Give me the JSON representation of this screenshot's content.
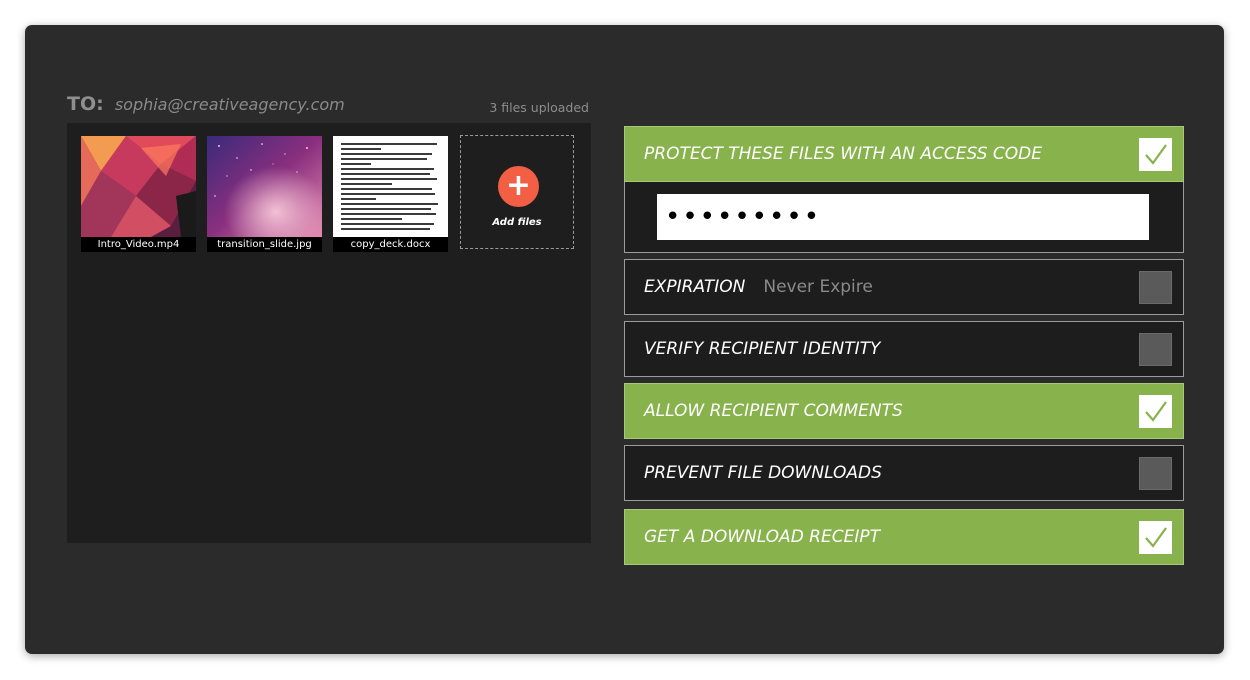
{
  "recipient": {
    "to_label": "TO:",
    "email": "sophia@creativeagency.com"
  },
  "upload_status": "3 files uploaded",
  "files": [
    {
      "name": "Intro_Video.mp4"
    },
    {
      "name": "transition_slide.jpg"
    },
    {
      "name": "copy_deck.docx"
    }
  ],
  "add_files_label": "Add files",
  "add_icon": "+",
  "options": {
    "access_code": {
      "label": "PROTECT THESE FILES WITH AN ACCESS CODE",
      "checked": true,
      "code_value": "•••••••••"
    },
    "expiration": {
      "label": "EXPIRATION",
      "value": "Never Expire",
      "checked": false
    },
    "verify_identity": {
      "label": "VERIFY RECIPIENT IDENTITY",
      "checked": false
    },
    "allow_comments": {
      "label": "ALLOW RECIPIENT COMMENTS",
      "checked": true
    },
    "prevent_downloads": {
      "label": "PREVENT FILE DOWNLOADS",
      "checked": false
    },
    "download_receipt": {
      "label": "GET A DOWNLOAD RECEIPT",
      "checked": true
    }
  },
  "colors": {
    "accent_green": "#88b24b",
    "add_button": "#f25f45",
    "window_bg": "#2b2b2b"
  },
  "icons": {
    "checkmark": "checkmark-icon",
    "add": "plus-icon"
  }
}
